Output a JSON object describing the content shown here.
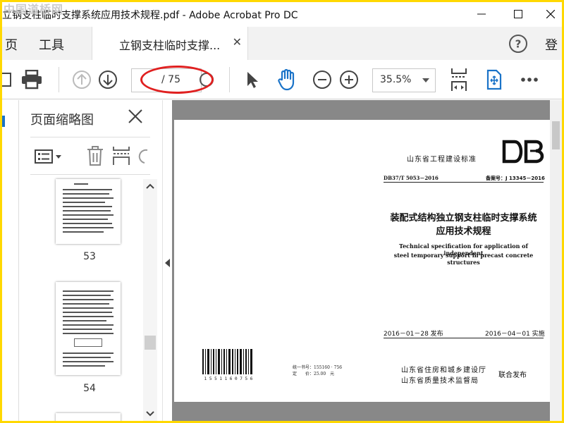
{
  "window": {
    "title": "立钢支柱临时支撑系统应用技术规程.pdf - Adobe Acrobat Pro DC",
    "watermark": "中国道桥网"
  },
  "menu": {
    "home": "页",
    "tools": "工具",
    "tab_label": "立钢支柱临时支撑...",
    "login": "登"
  },
  "toolbar": {
    "page_current": "",
    "page_total": "/ 75",
    "zoom": "35.5%"
  },
  "thumbnails": {
    "title": "页面缩略图",
    "pages": [
      "53",
      "54"
    ]
  },
  "document": {
    "issuer_top": "山东省工程建设标准",
    "logo": "DB",
    "code": "DB37/T 5053－2016",
    "record": "备案号：J 13345－2016",
    "title_line1": "装配式结构独立钢支柱临时支撑系统",
    "title_line2": "应用技术规程",
    "title_en_line1": "Technical specification for application of independent",
    "title_en_line2": "steel temporary support in precast concrete structures",
    "publish_date": "2016－01－28 发布",
    "implement_date": "2016－04－01 实施",
    "barcode_number": "1 5 5 1 1 6 0 7 5 6",
    "unified_book_no": "统一书号：155160 · 756",
    "price": "定　　价：25.00　元",
    "issuer_1": "山东省住房和城乡建设厅",
    "issuer_2": "山东省质量技术监督局",
    "joint_publish": "联合发布"
  },
  "colors": {
    "frame": "#ffd800",
    "accent_blue": "#1a73c8",
    "annotation_red": "#e02020",
    "doc_background": "#888888"
  }
}
